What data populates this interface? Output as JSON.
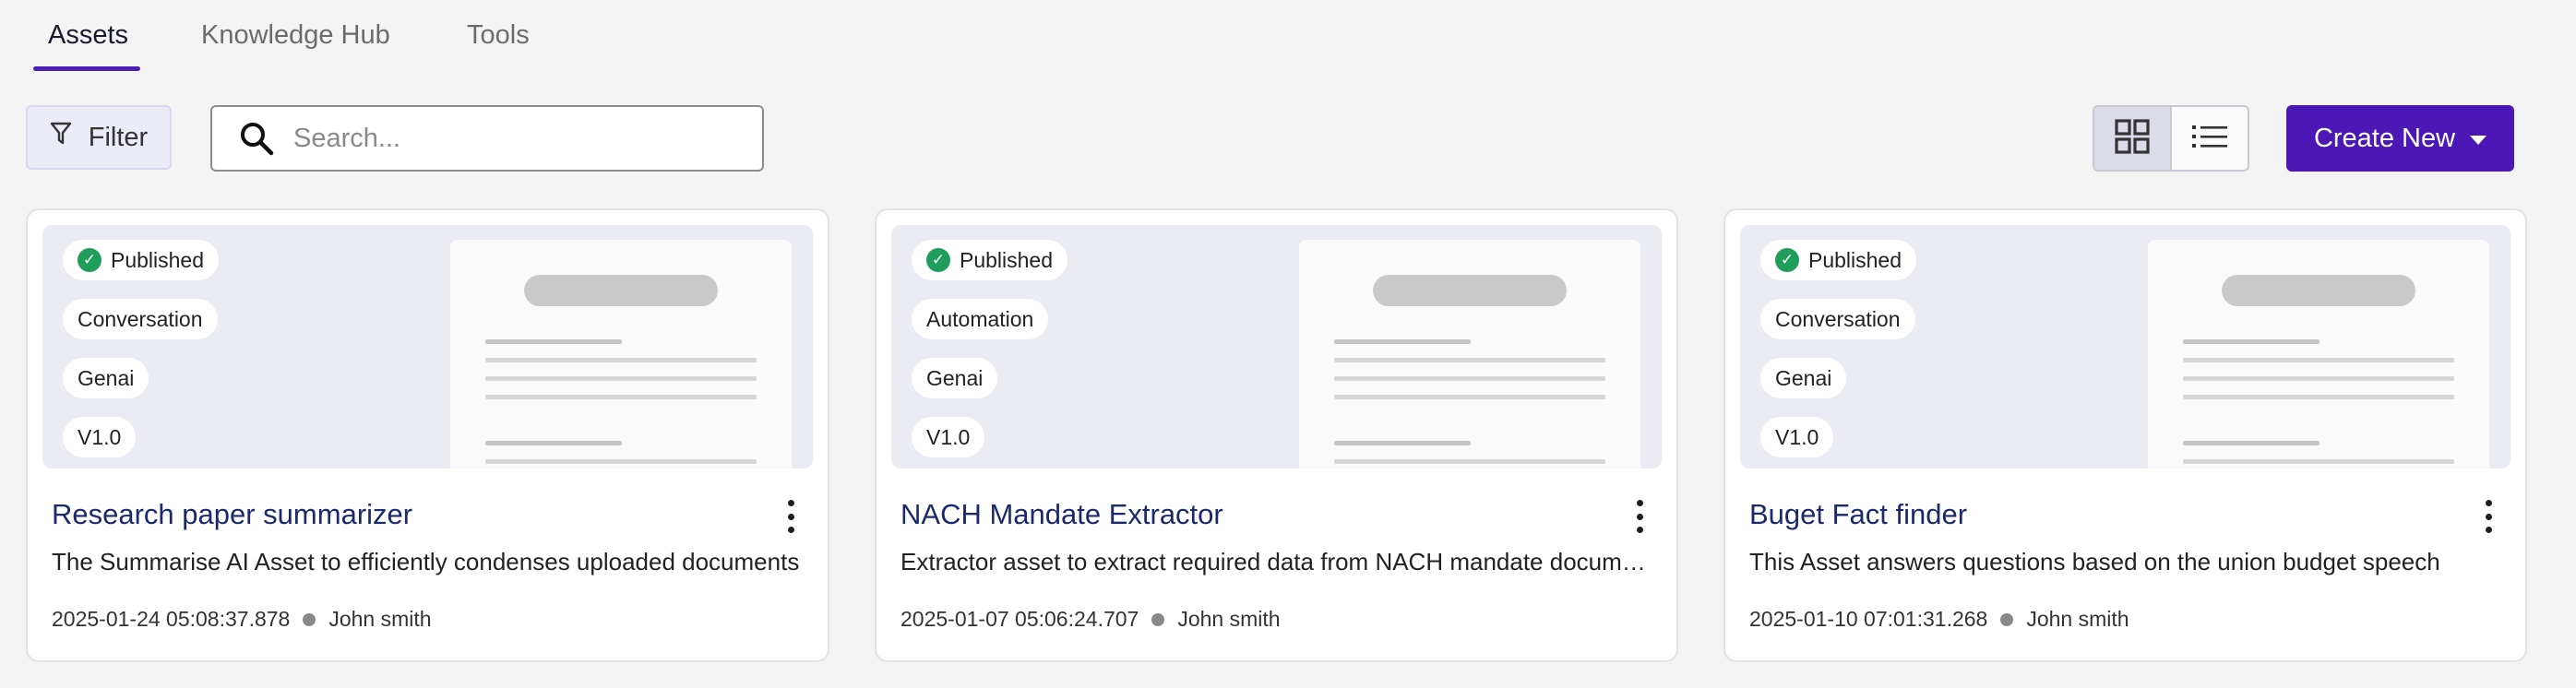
{
  "tabs": [
    {
      "label": "Assets",
      "active": true
    },
    {
      "label": "Knowledge Hub",
      "active": false
    },
    {
      "label": "Tools",
      "active": false
    }
  ],
  "toolbar": {
    "filter_label": "Filter",
    "search_placeholder": "Search...",
    "view_options": [
      "grid-view-icon",
      "list-view-icon"
    ],
    "active_view": "grid",
    "create_label": "Create New"
  },
  "colors": {
    "accent": "#4b17b5",
    "published": "#1e9e5a",
    "title": "#1a2a6c"
  },
  "cards": [
    {
      "status": "Published",
      "type": "Conversation",
      "category": "Genai",
      "version": "V1.0",
      "title": "Research paper summarizer",
      "description": "The Summarise AI Asset to efficiently condenses uploaded documents",
      "timestamp": "2025-01-24 05:08:37.878",
      "author": "John smith"
    },
    {
      "status": "Published",
      "type": "Automation",
      "category": "Genai",
      "version": "V1.0",
      "title": "NACH Mandate Extractor",
      "description": "Extractor asset to extract required data from NACH mandate documents",
      "timestamp": "2025-01-07 05:06:24.707",
      "author": "John smith"
    },
    {
      "status": "Published",
      "type": "Conversation",
      "category": "Genai",
      "version": "V1.0",
      "title": "Buget Fact finder",
      "description": "This Asset answers questions based on the union budget speech",
      "timestamp": "2025-01-10 07:01:31.268",
      "author": "John smith"
    }
  ]
}
